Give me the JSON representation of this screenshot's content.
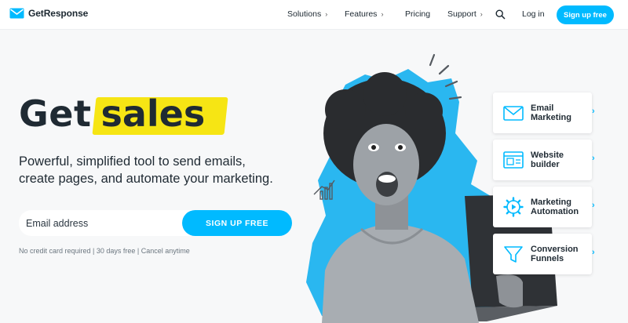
{
  "header": {
    "logo_text": "GetResponse",
    "nav": [
      {
        "label": "Solutions",
        "has_chevron": true
      },
      {
        "label": "Features",
        "has_chevron": true
      },
      {
        "label": "Pricing",
        "has_chevron": false
      },
      {
        "label": "Support",
        "has_chevron": true
      }
    ],
    "search_icon": "search-icon",
    "login_label": "Log in",
    "signup_label": "Sign up free"
  },
  "hero": {
    "headline_get": "Get",
    "headline_sales": "sales",
    "subtitle_line1": "Powerful, simplified tool to send emails,",
    "subtitle_line2": "create pages, and automate your marketing.",
    "email_placeholder": "Email address",
    "signup_button": "SIGN UP FREE",
    "note": "No credit card required | 30 days free | Cancel anytime"
  },
  "features": [
    {
      "label_line1": "Email",
      "label_line2": "Marketing",
      "icon": "envelope-icon"
    },
    {
      "label_line1": "Website",
      "label_line2": "builder",
      "icon": "website-icon"
    },
    {
      "label_line1": "Marketing",
      "label_line2": "Automation",
      "icon": "automation-gear-icon"
    },
    {
      "label_line1": "Conversion",
      "label_line2": "Funnels",
      "icon": "funnel-icon"
    }
  ],
  "colors": {
    "accent": "#00baff",
    "highlight": "#f6e514",
    "text": "#1f2a33",
    "background": "#f7f8f9"
  }
}
